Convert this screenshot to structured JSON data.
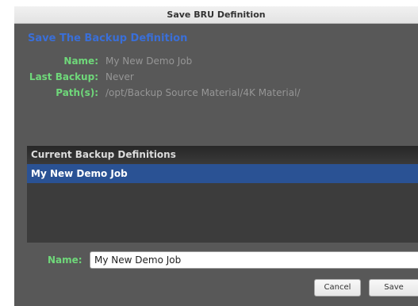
{
  "window": {
    "title": "Save BRU Definition"
  },
  "heading": "Save The Backup Definition",
  "info": {
    "name_label": "Name:",
    "name_value": "My New Demo Job",
    "last_backup_label": "Last Backup:",
    "last_backup_value": "Never",
    "paths_label": "Path(s):",
    "paths_value": "/opt/Backup Source Material/4K Material/"
  },
  "definitions": {
    "header": "Current Backup Definitions",
    "items": [
      {
        "label": "My New Demo Job",
        "selected": true
      }
    ]
  },
  "name_field": {
    "label": "Name:",
    "value": "My New Demo Job"
  },
  "buttons": {
    "cancel": "Cancel",
    "save": "Save"
  },
  "colors": {
    "background": "#585858",
    "heading": "#3a6fd8",
    "label": "#6fd87a",
    "value": "#969696",
    "selection": "#2a5294"
  }
}
